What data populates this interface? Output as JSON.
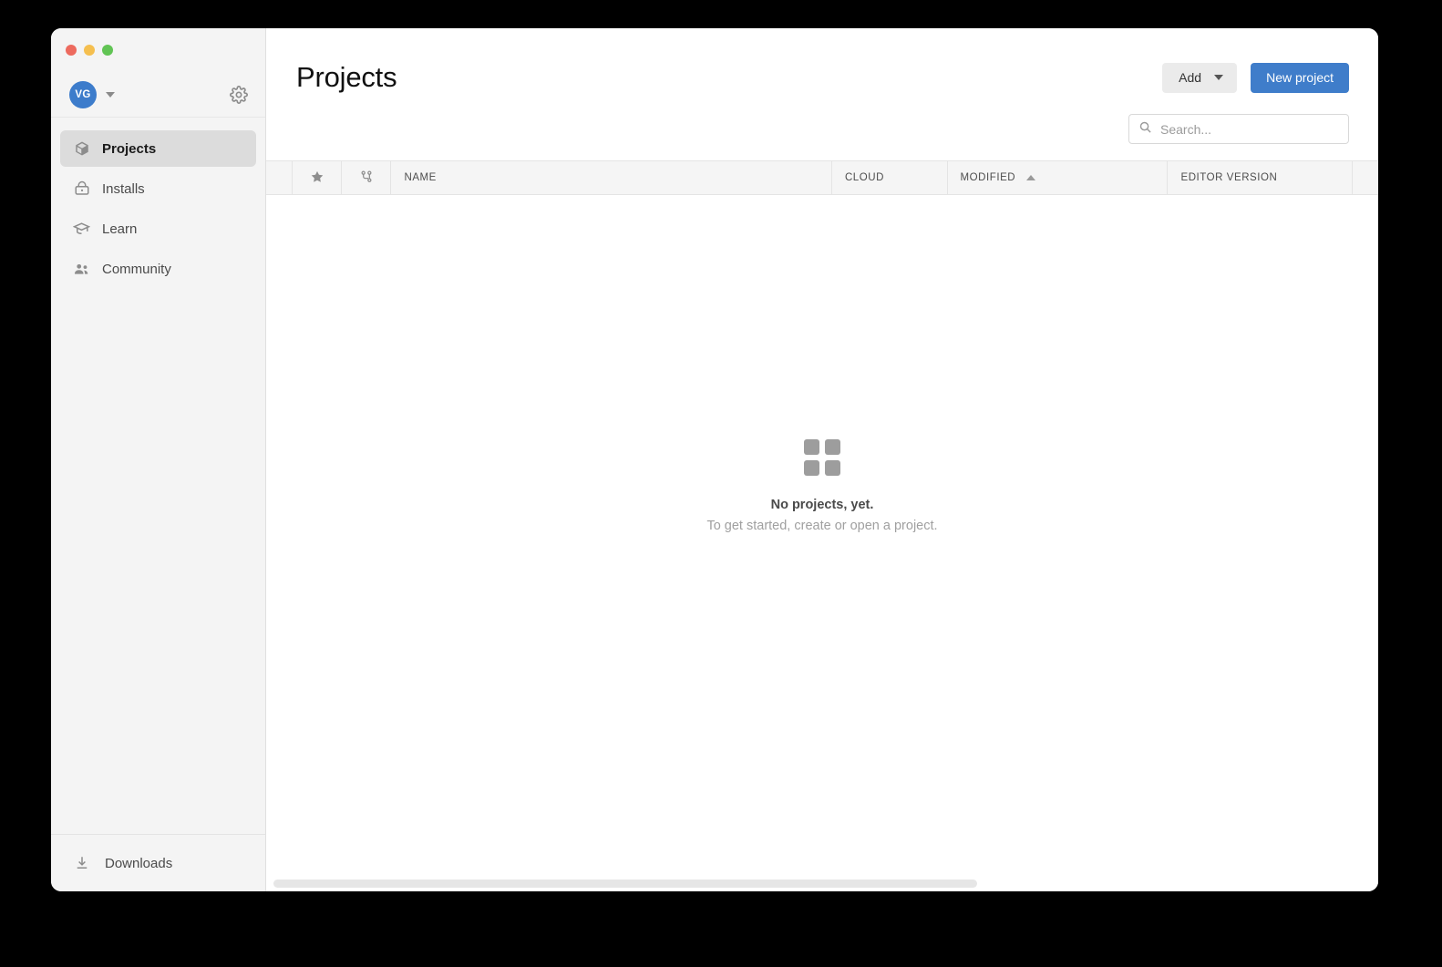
{
  "window": {
    "controls": [
      "close",
      "minimize",
      "maximize"
    ]
  },
  "sidebar": {
    "account": {
      "avatar_initials": "VG",
      "avatar_color": "#3d7ccb",
      "settings_icon": "gear-icon",
      "dropdown_icon": "chevron-down-icon"
    },
    "items": [
      {
        "label": "Projects",
        "icon": "cube-icon",
        "active": true
      },
      {
        "label": "Installs",
        "icon": "drive-icon",
        "active": false
      },
      {
        "label": "Learn",
        "icon": "graduation-cap-icon",
        "active": false
      },
      {
        "label": "Community",
        "icon": "people-icon",
        "active": false
      }
    ],
    "footer": {
      "label": "Downloads",
      "icon": "download-icon"
    }
  },
  "main": {
    "title": "Projects",
    "toolbar": {
      "add_label": "Add",
      "new_project_label": "New project",
      "new_project_color": "#3f7dca"
    },
    "search": {
      "placeholder": "Search...",
      "value": "",
      "icon": "search-icon"
    },
    "table": {
      "columns": [
        {
          "key": "spacer",
          "label": "",
          "type": "spacer"
        },
        {
          "key": "favorite",
          "label": "",
          "type": "icon",
          "icon": "star-icon"
        },
        {
          "key": "vcs",
          "label": "",
          "type": "icon",
          "icon": "branch-icon"
        },
        {
          "key": "name",
          "label": "NAME",
          "type": "text"
        },
        {
          "key": "cloud",
          "label": "CLOUD",
          "type": "text"
        },
        {
          "key": "modified",
          "label": "MODIFIED",
          "type": "text",
          "sorted": "asc"
        },
        {
          "key": "editor",
          "label": "EDITOR VERSION",
          "type": "text"
        },
        {
          "key": "actions",
          "label": "",
          "type": "spacer"
        }
      ],
      "rows": []
    },
    "empty_state": {
      "icon": "grid-squares-icon",
      "title": "No projects, yet.",
      "subtitle": "To get started, create or open a project."
    },
    "scrollbar": {
      "orientation": "horizontal",
      "thumb_ratio": 0.65
    }
  }
}
